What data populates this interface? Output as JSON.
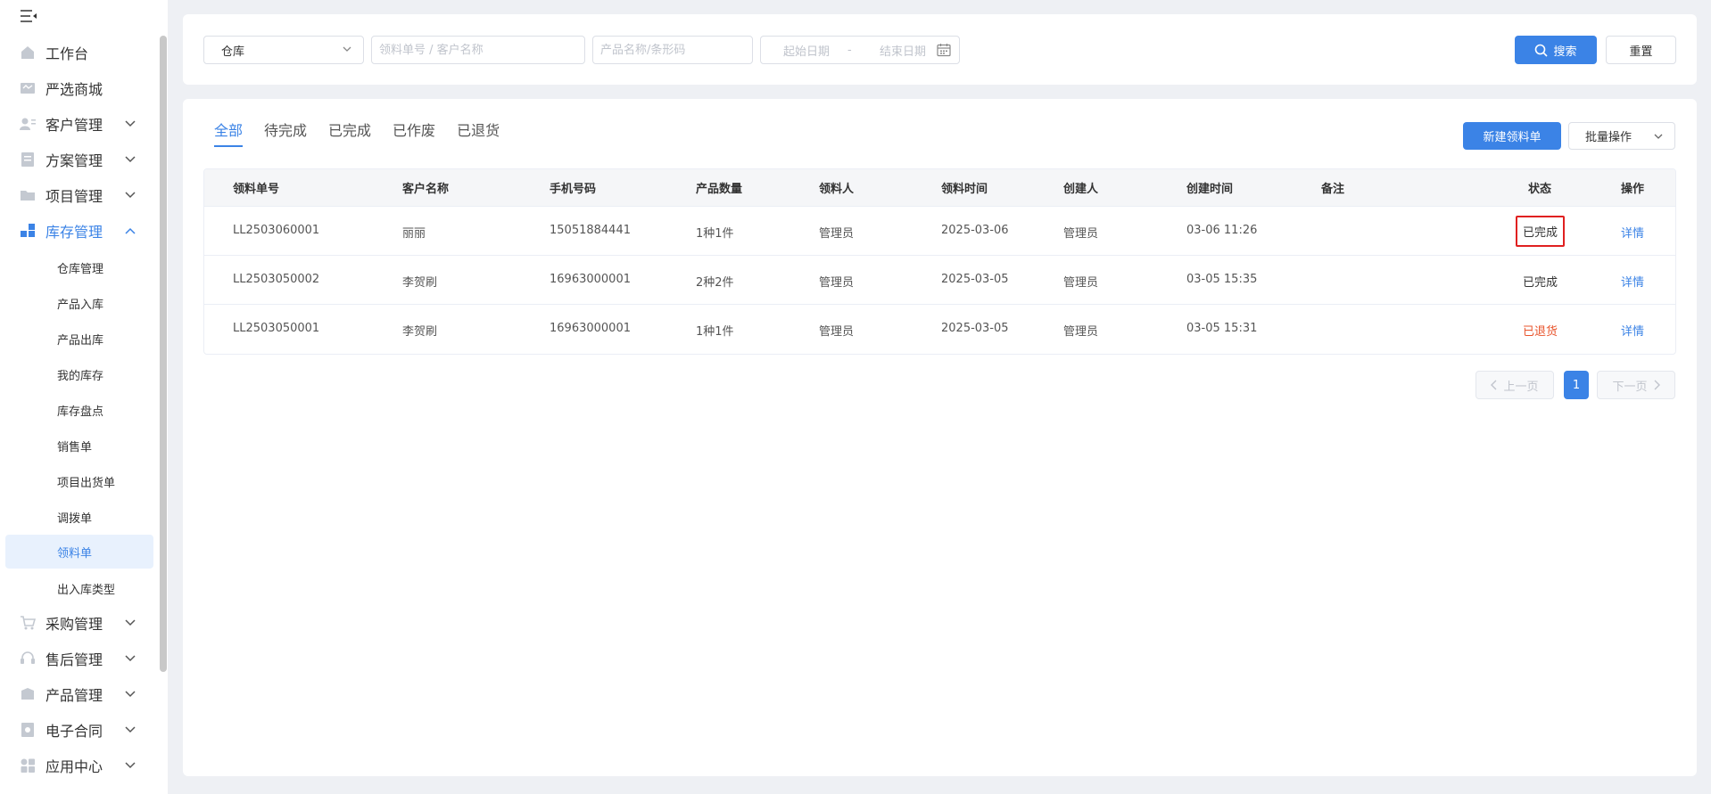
{
  "sidebar": {
    "collapse_icon": "menu-fold-icon",
    "top_items": [
      {
        "label": "工作台",
        "icon": "home-icon"
      },
      {
        "label": "严选商城",
        "icon": "mall-icon"
      },
      {
        "label": "客户管理",
        "icon": "customer-icon"
      },
      {
        "label": "方案管理",
        "icon": "plan-icon"
      },
      {
        "label": "项目管理",
        "icon": "folder-icon"
      },
      {
        "label": "库存管理",
        "icon": "inventory-icon"
      }
    ],
    "sub_items": [
      {
        "label": "仓库管理"
      },
      {
        "label": "产品入库"
      },
      {
        "label": "产品出库"
      },
      {
        "label": "我的库存"
      },
      {
        "label": "库存盘点"
      },
      {
        "label": "销售单"
      },
      {
        "label": "项目出货单"
      },
      {
        "label": "调拨单"
      },
      {
        "label": "领料单"
      },
      {
        "label": "出入库类型"
      }
    ],
    "bottom_items": [
      {
        "label": "采购管理",
        "icon": "cart-icon"
      },
      {
        "label": "售后管理",
        "icon": "headset-icon"
      },
      {
        "label": "产品管理",
        "icon": "box-icon"
      },
      {
        "label": "电子合同",
        "icon": "contract-icon"
      },
      {
        "label": "应用中心",
        "icon": "apps-icon"
      }
    ],
    "active_item": "库存管理",
    "active_sub_item": "领料单"
  },
  "filters": {
    "warehouse_select": "仓库",
    "order_placeholder": "领料单号 / 客户名称",
    "product_placeholder": "产品名称/条形码",
    "start_date_placeholder": "起始日期",
    "date_separator": "-",
    "end_date_placeholder": "结束日期",
    "search_label": "搜索",
    "reset_label": "重置"
  },
  "tabs": [
    {
      "label": "全部",
      "active": true
    },
    {
      "label": "待完成"
    },
    {
      "label": "已完成"
    },
    {
      "label": "已作废"
    },
    {
      "label": "已退货"
    }
  ],
  "actions": {
    "new_label": "新建领料单",
    "batch_label": "批量操作"
  },
  "table": {
    "headers": [
      "领料单号",
      "客户名称",
      "手机号码",
      "产品数量",
      "领料人",
      "领料时间",
      "创建人",
      "创建时间",
      "备注",
      "状态",
      "操作"
    ],
    "rows": [
      {
        "order_no": "LL2503060001",
        "customer": "丽丽",
        "phone": "15051884441",
        "qty": "1种1件",
        "picker": "管理员",
        "pick_date": "2025-03-06",
        "creator": "管理员",
        "created": "03-06 11:26",
        "remark": "",
        "status": "已完成",
        "action": "详情"
      },
      {
        "order_no": "LL2503050002",
        "customer": "李贺刷",
        "phone": "16963000001",
        "qty": "2种2件",
        "picker": "管理员",
        "pick_date": "2025-03-05",
        "creator": "管理员",
        "created": "03-05 15:35",
        "remark": "",
        "status": "已完成",
        "action": "详情"
      },
      {
        "order_no": "LL2503050001",
        "customer": "李贺刷",
        "phone": "16963000001",
        "qty": "1种1件",
        "picker": "管理员",
        "pick_date": "2025-03-05",
        "creator": "管理员",
        "created": "03-05 15:31",
        "remark": "",
        "status": "已退货",
        "action": "详情"
      }
    ]
  },
  "pagination": {
    "prev_label": "上一页",
    "current_page": "1",
    "next_label": "下一页"
  },
  "colors": {
    "accent": "#3b83e6",
    "returned_status": "#e8542c",
    "highlight_box": "#e02020"
  }
}
